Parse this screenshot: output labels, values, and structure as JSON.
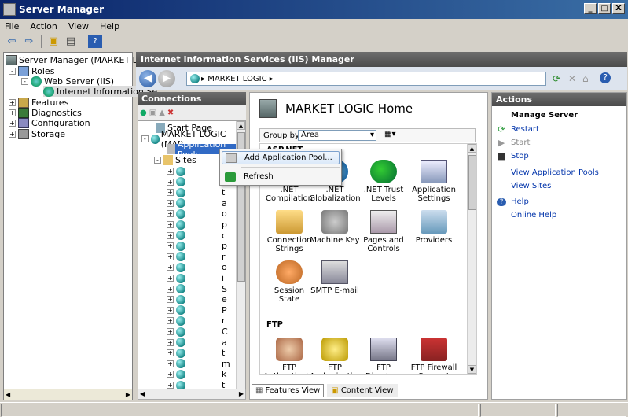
{
  "window": {
    "title": "Server Manager",
    "buttons": [
      "_",
      "□",
      "X"
    ]
  },
  "menu": [
    "File",
    "Action",
    "View",
    "Help"
  ],
  "left_tree": {
    "items": [
      {
        "label": "Server Manager (MARKET LOGIC)",
        "expander": "-",
        "level": 0,
        "icon": "server-icon"
      },
      {
        "label": "Roles",
        "expander": "-",
        "level": 1,
        "icon": "roles-icon"
      },
      {
        "label": "Web Server (IIS)",
        "expander": "-",
        "level": 2,
        "icon": "web-server-icon"
      },
      {
        "label": "Internet Information Se",
        "expander": "",
        "level": 3,
        "icon": "iis-icon"
      },
      {
        "label": "Features",
        "expander": "+",
        "level": 1,
        "icon": "features-icon"
      },
      {
        "label": "Diagnostics",
        "expander": "+",
        "level": 1,
        "icon": "diagnostics-icon"
      },
      {
        "label": "Configuration",
        "expander": "+",
        "level": 1,
        "icon": "configuration-icon"
      },
      {
        "label": "Storage",
        "expander": "+",
        "level": 1,
        "icon": "storage-icon"
      }
    ]
  },
  "iis": {
    "header": "Internet Information Services (IIS) Manager",
    "address": "▸ MARKET LOGIC ▸",
    "back_label": "◀",
    "forward_label": "▶"
  },
  "connections": {
    "header": "Connections",
    "start_page": "Start Page",
    "server": "MARKET LOGIC (MAR",
    "app_pools": "Application Pools",
    "sites": "Sites",
    "site_count": 25,
    "site_letters": [
      "a",
      "d",
      "t",
      "a",
      "o",
      "p",
      "c",
      "p",
      "r",
      "o",
      "i",
      "S",
      "e",
      "P",
      "r",
      "C",
      "a",
      "t",
      "m",
      "k",
      "t",
      "a",
      "",
      "",
      "s"
    ]
  },
  "center": {
    "title": "MARKET LOGIC Home",
    "group_by_label": "Group by:",
    "group_by_value": "Area",
    "sections": [
      {
        "title": "ASP.NET",
        "features": [
          ".NET Compilation",
          ".NET Globalization",
          ".NET Trust Levels",
          "Application Settings",
          "Connection Strings",
          "Machine Key",
          "Pages and Controls",
          "Providers",
          "Session State",
          "SMTP E-mail"
        ]
      },
      {
        "title": "FTP",
        "features": [
          "FTP Authentication",
          "FTP Authorizati...",
          "FTP Directory Browsing",
          "FTP Firewall Support"
        ]
      }
    ],
    "view_tabs": [
      "Features View",
      "Content View"
    ]
  },
  "actions": {
    "header": "Actions",
    "title": "Manage Server",
    "items": [
      {
        "label": "Restart",
        "icon": "restart-icon",
        "state": "link"
      },
      {
        "label": "Start",
        "icon": "start-icon",
        "state": "disabled"
      },
      {
        "label": "Stop",
        "icon": "stop-icon",
        "state": "link"
      },
      {
        "label": "View Application Pools",
        "icon": "",
        "state": "link"
      },
      {
        "label": "View Sites",
        "icon": "",
        "state": "link"
      },
      {
        "label": "Help",
        "icon": "help-icon",
        "state": "link"
      },
      {
        "label": "Online Help",
        "icon": "",
        "state": "link"
      }
    ]
  },
  "context_menu": {
    "items": [
      "Add Application Pool...",
      "Refresh"
    ]
  }
}
